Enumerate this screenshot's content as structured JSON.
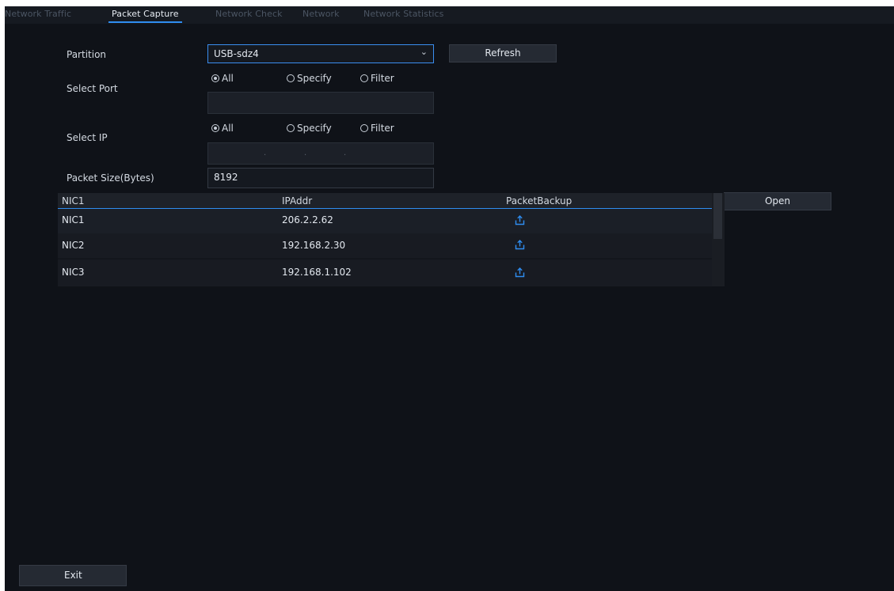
{
  "tabs": [
    "Network Traffic",
    "Packet Capture",
    "Network Check",
    "Network",
    "Network Statistics"
  ],
  "form": {
    "partition_label": "Partition",
    "partition_value": "USB-sdz4",
    "refresh_label": "Refresh",
    "select_port_label": "Select Port",
    "port_options": [
      "All",
      "Specify",
      "Filter"
    ],
    "select_ip_label": "Select IP",
    "ip_options": [
      "All",
      "Specify",
      "Filter"
    ],
    "packet_size_label": "Packet Size(Bytes)",
    "packet_size_value": "8192",
    "open_label": "Open"
  },
  "table": {
    "headers": [
      "NIC1",
      "IPAddr",
      "PacketBackup"
    ],
    "rows": [
      {
        "nic": "NIC1",
        "ip": "206.2.2.62"
      },
      {
        "nic": "NIC2",
        "ip": "192.168.2.30"
      },
      {
        "nic": "NIC3",
        "ip": "192.168.1.102"
      }
    ]
  },
  "footer": {
    "exit_label": "Exit"
  },
  "colors": {
    "accent": "#2f8df0",
    "background": "#0f1218"
  }
}
